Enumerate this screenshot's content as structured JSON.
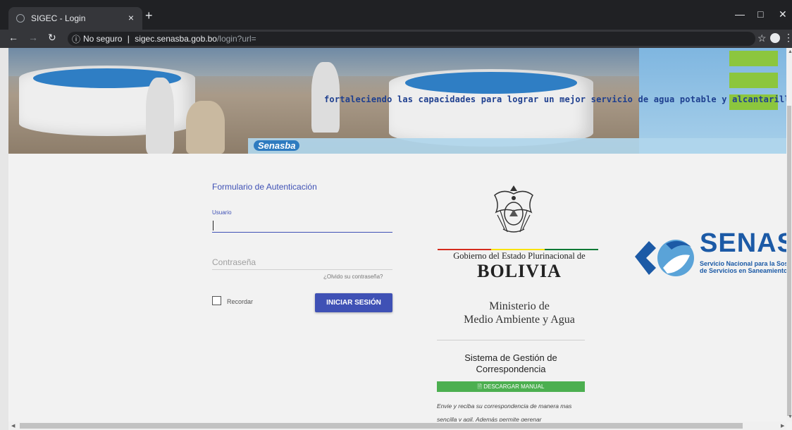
{
  "browser": {
    "tab_title": "SIGEC - Login",
    "tab_close": "×",
    "new_tab": "+",
    "security_label": "No seguro",
    "separator": "|",
    "url_host": "sigec.senasba.gob.bo",
    "url_path": "/login?url="
  },
  "banner": {
    "logo_text": "Senasba",
    "slogan": "fortaleciendo las capacidades para lograr un mejor servicio de agua potable y alcantarillado sanitario"
  },
  "login": {
    "form_title": "Formulario de Autenticación",
    "username_label": "Usuario",
    "username_value": "",
    "password_placeholder": "Contraseña",
    "forgot_password": "¿Olvido su contraseña?",
    "remember_label": "Recordar",
    "remember_checked": false,
    "submit_label": "INICIAR SESIÓN"
  },
  "government": {
    "line1": "Gobierno del Estado Plurinacional de",
    "country": "BOLIVIA",
    "ministry_line1": "Ministerio de",
    "ministry_line2": "Medio Ambiente y Agua"
  },
  "system": {
    "name_line1": "Sistema de Gestión de",
    "name_line2": "Correspondencia",
    "download_button": "DESCARGAR MANUAL",
    "description": "Envie y reciba su correspondencia de manera mas sencilla y agil. Además permite gerenar"
  },
  "senasba_logo": {
    "wordmark": "SENASBA",
    "subtitle_line1": "Servicio Nacional para la Sostenibilidad",
    "subtitle_line2": "de Servicios en Saneamiento Básico"
  },
  "colors": {
    "primary": "#3f51b5",
    "download_green": "#4caf50",
    "senasba_blue": "#1c5aa6",
    "flag_red": "#d52b1e",
    "flag_yellow": "#f9e300",
    "flag_green": "#007934"
  }
}
